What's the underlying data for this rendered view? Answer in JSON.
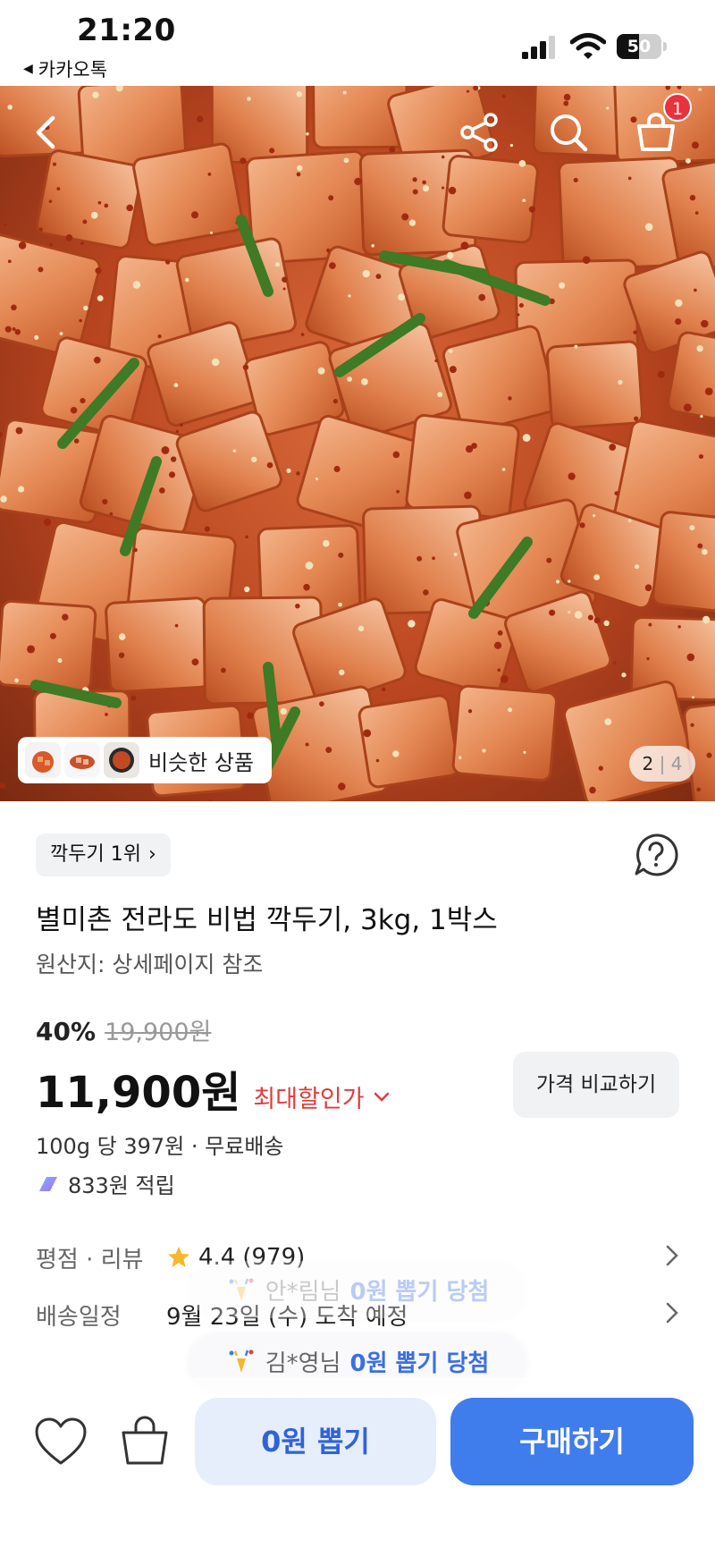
{
  "status_bar": {
    "time": "21:20",
    "back_app": "카카오톡",
    "battery_level": "50",
    "battery_fraction": 0.5,
    "icons": [
      "cellular-signal-icon",
      "wifi-icon",
      "battery-icon"
    ]
  },
  "header": {
    "icons": [
      "back-arrow-icon",
      "share-icon",
      "search-icon",
      "cart-icon"
    ],
    "cart_badge": "1"
  },
  "gallery": {
    "similar_label": "비슷한 상품",
    "current": "2",
    "separator": "|",
    "total": "4"
  },
  "product": {
    "rank_label": "깍두기 1위",
    "title": "별미촌 전라도 비법 깍두기, 3kg, 1박스",
    "origin": "원산지: 상세페이지 참조",
    "discount_pct": "40%",
    "original_price": "19,900원",
    "price": "11,900원",
    "max_discount_label": "최대할인가",
    "compare_button": "가격 비교하기",
    "unit_price": "100g 당 397원 · 무료배송",
    "points": "833원 적립"
  },
  "details": {
    "rating_key": "평점 · 리뷰",
    "rating": "4.4",
    "review_count": "(979)",
    "delivery_key": "배송일정",
    "delivery_value": "9월 23일 (수) 도착 예정"
  },
  "toasts": [
    {
      "name": "안*림님",
      "message": "0원 뽑기 당첨"
    },
    {
      "name": "김*영님",
      "message": "0원 뽑기 당첨"
    }
  ],
  "bottom_bar": {
    "draw_button": "0원 뽑기",
    "buy_button": "구매하기"
  },
  "colors": {
    "accent_blue": "#3f7cec",
    "discount_red": "#e23c3c",
    "badge_red": "#e8323c",
    "star_gold": "#f5b82e"
  }
}
